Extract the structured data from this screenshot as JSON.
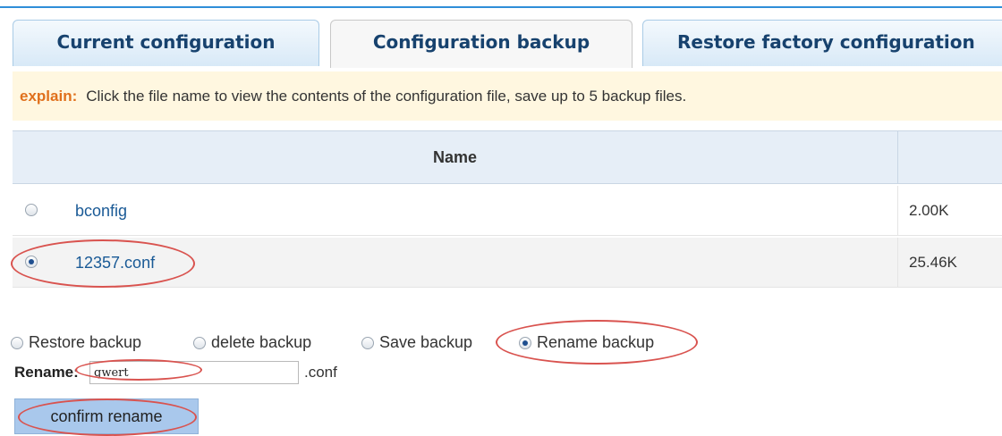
{
  "tabs": [
    {
      "label": "Current configuration"
    },
    {
      "label": "Configuration backup"
    },
    {
      "label": "Restore factory configuration"
    }
  ],
  "explain": {
    "label": "explain:",
    "text": "Click the file name to view the contents of the configuration file, save up to 5 backup files."
  },
  "table": {
    "header_name": "Name",
    "rows": [
      {
        "name": "bconfig",
        "size": "2.00K",
        "selected": false
      },
      {
        "name": "12357.conf",
        "size": "25.46K",
        "selected": true
      }
    ]
  },
  "options": [
    {
      "label": "Restore backup",
      "selected": false
    },
    {
      "label": "delete backup",
      "selected": false
    },
    {
      "label": "Save backup",
      "selected": false
    },
    {
      "label": "Rename backup",
      "selected": true
    }
  ],
  "rename": {
    "label": "Rename:",
    "value": "qwert",
    "suffix": ".conf"
  },
  "confirm_label": "confirm rename",
  "colors": {
    "accent": "#2f8ed8",
    "annotation": "#d9534f",
    "explain_label": "#e0701c"
  }
}
